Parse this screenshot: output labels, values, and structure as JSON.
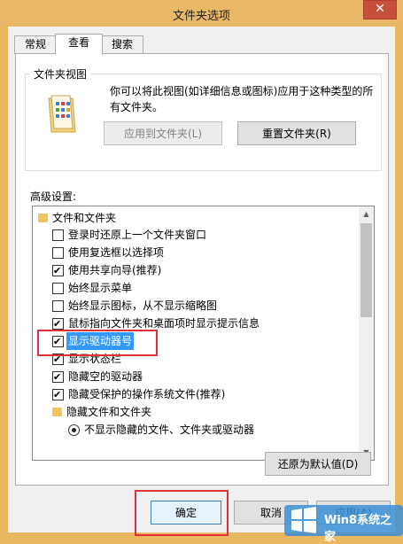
{
  "window": {
    "title": "文件夹选项",
    "close_glyph": "✕"
  },
  "tabs": [
    {
      "label": "常规"
    },
    {
      "label": "查看"
    },
    {
      "label": "搜索"
    }
  ],
  "folder_views": {
    "legend": "文件夹视图",
    "description": "你可以将此视图(如详细信息或图标)应用于这种类型的所有文件夹。",
    "apply_label": "应用到文件夹(L)",
    "reset_label": "重置文件夹(R)"
  },
  "advanced": {
    "label": "高级设置:",
    "items": [
      {
        "text": "文件和文件夹",
        "kind": "folder"
      },
      {
        "text": "登录时还原上一个文件夹窗口",
        "kind": "checkbox",
        "checked": false
      },
      {
        "text": "使用复选框以选择项",
        "kind": "checkbox",
        "checked": false
      },
      {
        "text": "使用共享向导(推荐)",
        "kind": "checkbox",
        "checked": true
      },
      {
        "text": "始终显示菜单",
        "kind": "checkbox",
        "checked": false
      },
      {
        "text": "始终显示图标，从不显示缩略图",
        "kind": "checkbox",
        "checked": false
      },
      {
        "text": "鼠标指向文件夹和桌面项时显示提示信息",
        "kind": "checkbox",
        "checked": true
      },
      {
        "text": "显示驱动器号",
        "kind": "checkbox",
        "checked": true,
        "selected": true
      },
      {
        "text": "显示状态栏",
        "kind": "checkbox",
        "checked": true
      },
      {
        "text": "隐藏空的驱动器",
        "kind": "checkbox",
        "checked": true
      },
      {
        "text": "隐藏受保护的操作系统文件(推荐)",
        "kind": "checkbox",
        "checked": true
      },
      {
        "text": "隐藏文件和文件夹",
        "kind": "folder"
      },
      {
        "text": "不显示隐藏的文件、文件夹或驱动器",
        "kind": "radio",
        "checked": true
      }
    ],
    "restore_label": "还原为默认值(D)"
  },
  "footer": {
    "ok_label": "确定",
    "cancel_label": "取消",
    "apply_label": "应用(A)"
  },
  "watermark": {
    "text": "Win8系统之家"
  },
  "colors": {
    "title_bar": "#e9b866",
    "close_button": "#c7503b",
    "selection": "#3399ff",
    "annotation": "#e0303a"
  }
}
